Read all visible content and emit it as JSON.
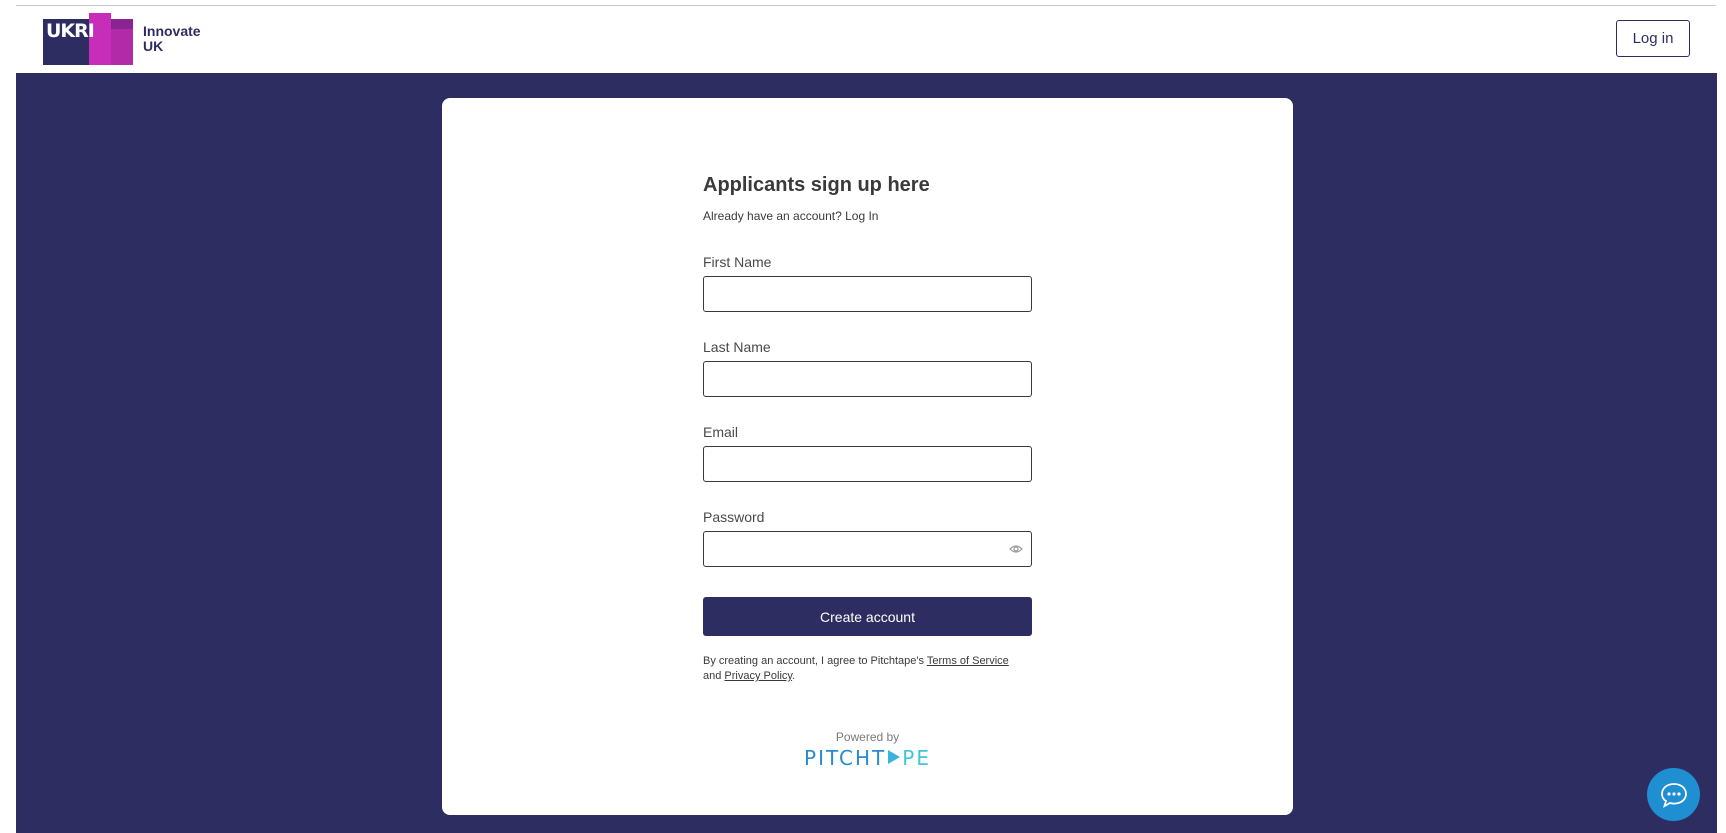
{
  "header": {
    "brand_line1": "Innovate",
    "brand_line2": "UK",
    "logo_mark_text": "UKRI",
    "login_label": "Log in"
  },
  "form": {
    "title": "Applicants sign up here",
    "already_text": "Already have an account?",
    "login_link": "Log In",
    "fields": [
      {
        "label": "First Name",
        "value": ""
      },
      {
        "label": "Last Name",
        "value": ""
      },
      {
        "label": "Email",
        "value": ""
      },
      {
        "label": "Password",
        "value": ""
      }
    ],
    "submit_label": "Create account",
    "terms_prefix": "By creating an account, I agree to Pitchtape's",
    "terms_link": "Terms of Service",
    "terms_and": "and",
    "privacy_link": "Privacy Policy",
    "terms_suffix": "."
  },
  "footer": {
    "powered_by": "Powered by",
    "brand_left": "PITCHT",
    "brand_right": "PE"
  },
  "icons": {
    "password_toggle": "eye-icon",
    "chat": "chat-bubble-icon"
  },
  "colors": {
    "primary": "#2e2d62",
    "accent_pink": "#c62eb9",
    "chat_blue": "#1f8fd1",
    "pitchtape_blue": "#2a8bd0"
  }
}
